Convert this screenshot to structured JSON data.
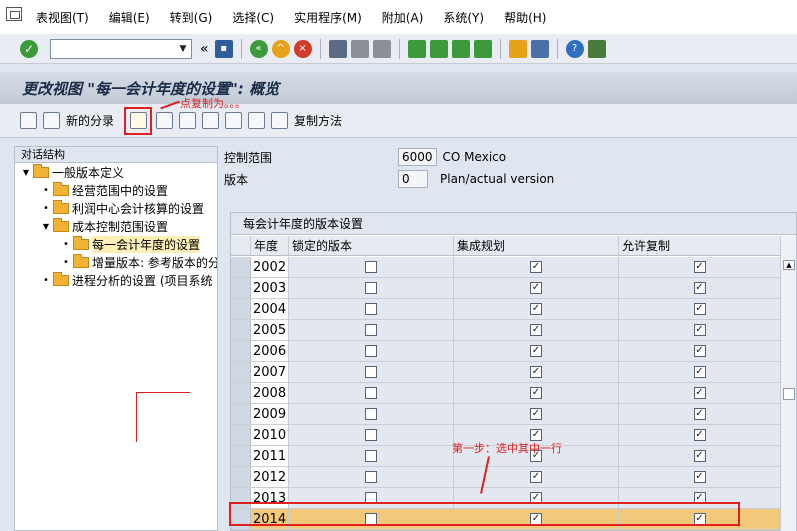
{
  "menu": [
    "表视图(T)",
    "编辑(E)",
    "转到(G)",
    "选择(C)",
    "实用程序(M)",
    "附加(A)",
    "系统(Y)",
    "帮助(H)"
  ],
  "title": "更改视图 \"每一会计年度的设置\": 概览",
  "app_toolbar": {
    "new_entries": "新的分录",
    "copy_method": "复制方法"
  },
  "annotations": {
    "copy_hint": "点复制为。。。",
    "step1": "第一步：选中其中一行"
  },
  "tree": {
    "header": "对话结构",
    "items": [
      {
        "label": "一般版本定义",
        "level": 0,
        "kind": "open"
      },
      {
        "label": "经营范围中的设置",
        "level": 1,
        "kind": "leaf"
      },
      {
        "label": "利润中心会计核算的设置",
        "level": 1,
        "kind": "leaf"
      },
      {
        "label": "成本控制范围设置",
        "level": 1,
        "kind": "open"
      },
      {
        "label": "每一会计年度的设置",
        "level": 2,
        "kind": "leaf",
        "selected": true
      },
      {
        "label": "增量版本: 参考版本的分",
        "level": 2,
        "kind": "leaf"
      },
      {
        "label": "进程分析的设置 (项目系统",
        "level": 1,
        "kind": "leaf"
      }
    ]
  },
  "fields": {
    "controlling_area": {
      "label": "控制范围",
      "value": "6000",
      "desc": "CO Mexico"
    },
    "version": {
      "label": "版本",
      "value": "0",
      "desc": "Plan/actual version"
    }
  },
  "table": {
    "title": "每会计年度的版本设置",
    "columns": [
      "年度",
      "锁定的版本",
      "集成规划",
      "允许复制"
    ],
    "rows": [
      {
        "year": "2002",
        "locked": false,
        "integrated": true,
        "copy": true
      },
      {
        "year": "2003",
        "locked": false,
        "integrated": true,
        "copy": true
      },
      {
        "year": "2004",
        "locked": false,
        "integrated": true,
        "copy": true
      },
      {
        "year": "2005",
        "locked": false,
        "integrated": true,
        "copy": true
      },
      {
        "year": "2006",
        "locked": false,
        "integrated": true,
        "copy": true
      },
      {
        "year": "2007",
        "locked": false,
        "integrated": true,
        "copy": true
      },
      {
        "year": "2008",
        "locked": false,
        "integrated": true,
        "copy": true
      },
      {
        "year": "2009",
        "locked": false,
        "integrated": true,
        "copy": true
      },
      {
        "year": "2010",
        "locked": false,
        "integrated": true,
        "copy": true
      },
      {
        "year": "2011",
        "locked": false,
        "integrated": true,
        "copy": true
      },
      {
        "year": "2012",
        "locked": false,
        "integrated": true,
        "copy": true
      },
      {
        "year": "2013",
        "locked": false,
        "integrated": true,
        "copy": true
      },
      {
        "year": "2014",
        "locked": false,
        "integrated": true,
        "copy": true,
        "selected": true
      }
    ]
  },
  "colors": {
    "accent_red": "#e02020",
    "selected_row": "#f2c97a",
    "title_text": "#1b2a46"
  }
}
